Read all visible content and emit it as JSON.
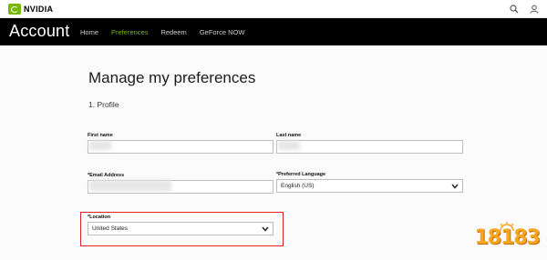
{
  "topbar": {
    "logo_text": "NVIDIA",
    "icons": [
      "search-icon",
      "user-icon"
    ]
  },
  "navbar": {
    "brand": "Account",
    "items": [
      {
        "label": "Home",
        "active": false
      },
      {
        "label": "Preferences",
        "active": true
      },
      {
        "label": "Redeem",
        "active": false
      },
      {
        "label": "GeForce NOW",
        "active": false
      }
    ]
  },
  "page": {
    "title": "Manage my preferences",
    "section": "1. Profile"
  },
  "form": {
    "first_name": {
      "label": "First name",
      "value": ""
    },
    "last_name": {
      "label": "Last name",
      "value": ""
    },
    "email": {
      "label": "*Email Address",
      "value": ""
    },
    "language": {
      "label": "*Preferred Language",
      "value": "English (US)"
    },
    "location": {
      "label": "*Location",
      "value": "United States"
    }
  },
  "watermark": {
    "text": "18183"
  },
  "colors": {
    "accent": "#76b900",
    "highlight": "#d9262b",
    "navbar_bg": "#000000"
  }
}
